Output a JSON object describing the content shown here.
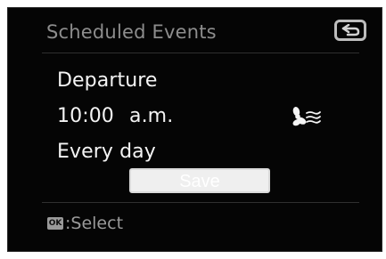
{
  "header": {
    "title": "Scheduled Events",
    "back_icon": "back-arrow-icon"
  },
  "event": {
    "type": "Departure",
    "time": "10:00",
    "period": "a.m.",
    "repeat": "Every day",
    "mode_icon": "fan-icon"
  },
  "actions": {
    "save_label": "Save"
  },
  "footer": {
    "badge_label": "OK",
    "hint": ":Select"
  },
  "colors": {
    "background": "#050505",
    "title": "#8d8d8d",
    "text": "#f4f4f4",
    "border": "#dadada",
    "footer": "#9a9a9a"
  }
}
